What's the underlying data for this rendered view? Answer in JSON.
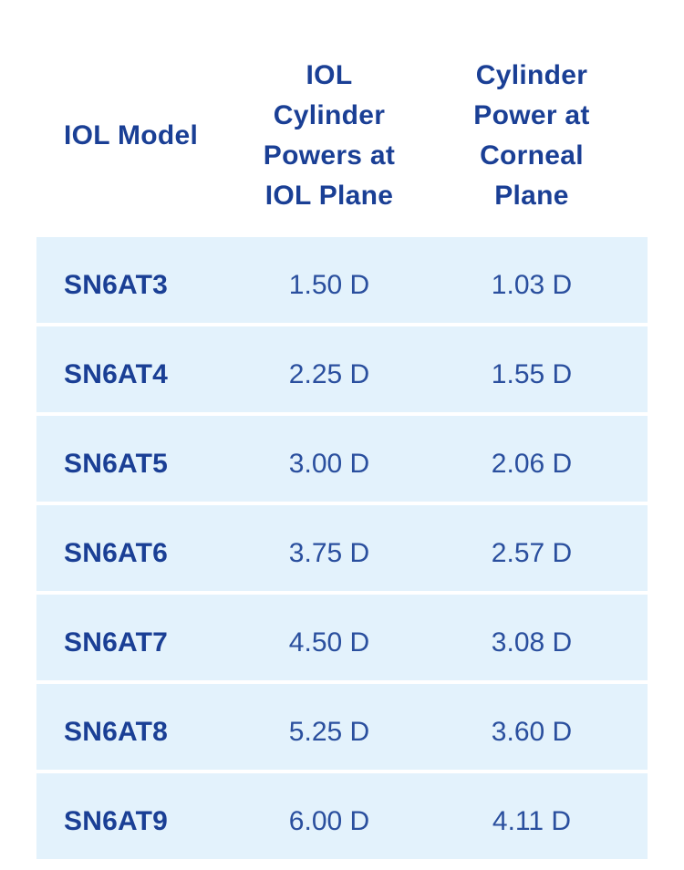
{
  "header": {
    "model": "IOL Model",
    "iol_lines": [
      "IOL",
      "Cylinder",
      "Powers at",
      "IOL Plane"
    ],
    "corneal_lines": [
      "Cylinder",
      "Power at",
      "Corneal",
      "Plane"
    ]
  },
  "rows": [
    {
      "model": "SN6AT3",
      "iol": "1.50 D",
      "corneal": "1.03 D"
    },
    {
      "model": "SN6AT4",
      "iol": "2.25 D",
      "corneal": "1.55 D"
    },
    {
      "model": "SN6AT5",
      "iol": "3.00 D",
      "corneal": "2.06 D"
    },
    {
      "model": "SN6AT6",
      "iol": "3.75 D",
      "corneal": "2.57 D"
    },
    {
      "model": "SN6AT7",
      "iol": "4.50 D",
      "corneal": "3.08 D"
    },
    {
      "model": "SN6AT8",
      "iol": "5.25 D",
      "corneal": "3.60 D"
    },
    {
      "model": "SN6AT9",
      "iol": "6.00 D",
      "corneal": "4.11 D"
    }
  ],
  "colors": {
    "text_primary": "#1a3f95",
    "row_background": "#e3f2fc"
  }
}
